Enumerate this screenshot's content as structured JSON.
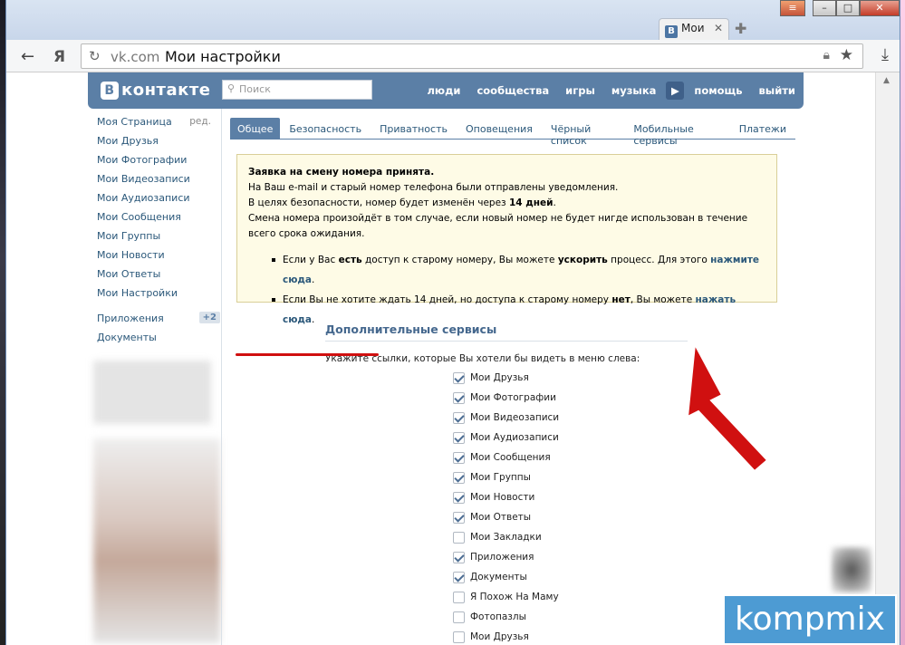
{
  "browser": {
    "tab_title": "Мои",
    "tab_favicon": "В",
    "url_domain": "vk.com",
    "url_title": "Мои настройки"
  },
  "vk": {
    "logo": "контакте",
    "logo_letter": "В",
    "search_placeholder": "Поиск",
    "menu": [
      "люди",
      "сообщества",
      "игры",
      "музыка",
      "помощь",
      "выйти"
    ]
  },
  "leftnav": {
    "items": [
      "Моя Страница",
      "Мои Друзья",
      "Мои Фотографии",
      "Мои Видеозаписи",
      "Мои Аудиозаписи",
      "Мои Сообщения",
      "Мои Группы",
      "Мои Новости",
      "Мои Ответы",
      "Мои Настройки"
    ],
    "edit": "ред.",
    "apps": "Приложения",
    "apps_badge": "+2",
    "docs": "Документы"
  },
  "tabs": [
    "Общее",
    "Безопасность",
    "Приватность",
    "Оповещения",
    "Чёрный список",
    "Мобильные сервисы",
    "Платежи"
  ],
  "notice": {
    "title": "Заявка на смену номера принята.",
    "line1": "На Ваш e-mail и старый номер телефона были отправлены уведомления.",
    "line2_pre": "В целях безопасности, номер будет изменён через ",
    "line2_bold": "14 дней",
    "line2_post": ".",
    "line3": "Смена номера произойдёт в том случае, если новый номер не будет нигде использован в течение всего срока ожидания.",
    "b1_a": "Если у Вас ",
    "b1_b": "есть",
    "b1_c": " доступ к старому номеру, Вы можете ",
    "b1_d": "ускорить",
    "b1_e": " процесс. Для этого ",
    "b1_link": "нажмите сюда",
    "b1_f": ".",
    "b2_a": "Если Вы не хотите ждать 14 дней, но доступа к старому номеру ",
    "b2_b": "нет",
    "b2_c": ", Вы можете ",
    "b2_link": "нажать сюда",
    "b2_d": "."
  },
  "services": {
    "title": "Дополнительные сервисы",
    "hint": "Укажите ссылки, которые Вы хотели бы видеть в меню слева:",
    "items": [
      {
        "label": "Мои Друзья",
        "checked": true
      },
      {
        "label": "Мои Фотографии",
        "checked": true
      },
      {
        "label": "Мои Видеозаписи",
        "checked": true
      },
      {
        "label": "Мои Аудиозаписи",
        "checked": true
      },
      {
        "label": "Мои Сообщения",
        "checked": true
      },
      {
        "label": "Мои Группы",
        "checked": true
      },
      {
        "label": "Мои Новости",
        "checked": true
      },
      {
        "label": "Мои Ответы",
        "checked": true
      },
      {
        "label": "Мои Закладки",
        "checked": false
      },
      {
        "label": "Приложения",
        "checked": true
      },
      {
        "label": "Документы",
        "checked": true
      },
      {
        "label": "Я Похож На Маму",
        "checked": false
      },
      {
        "label": "Фотопазлы",
        "checked": false
      },
      {
        "label": "Мои Друзья",
        "checked": false
      }
    ]
  },
  "watermark": "kompmix",
  "colors": {
    "vk_blue": "#5b7fa6",
    "link": "#2b587a",
    "annotation_red": "#d01010"
  }
}
